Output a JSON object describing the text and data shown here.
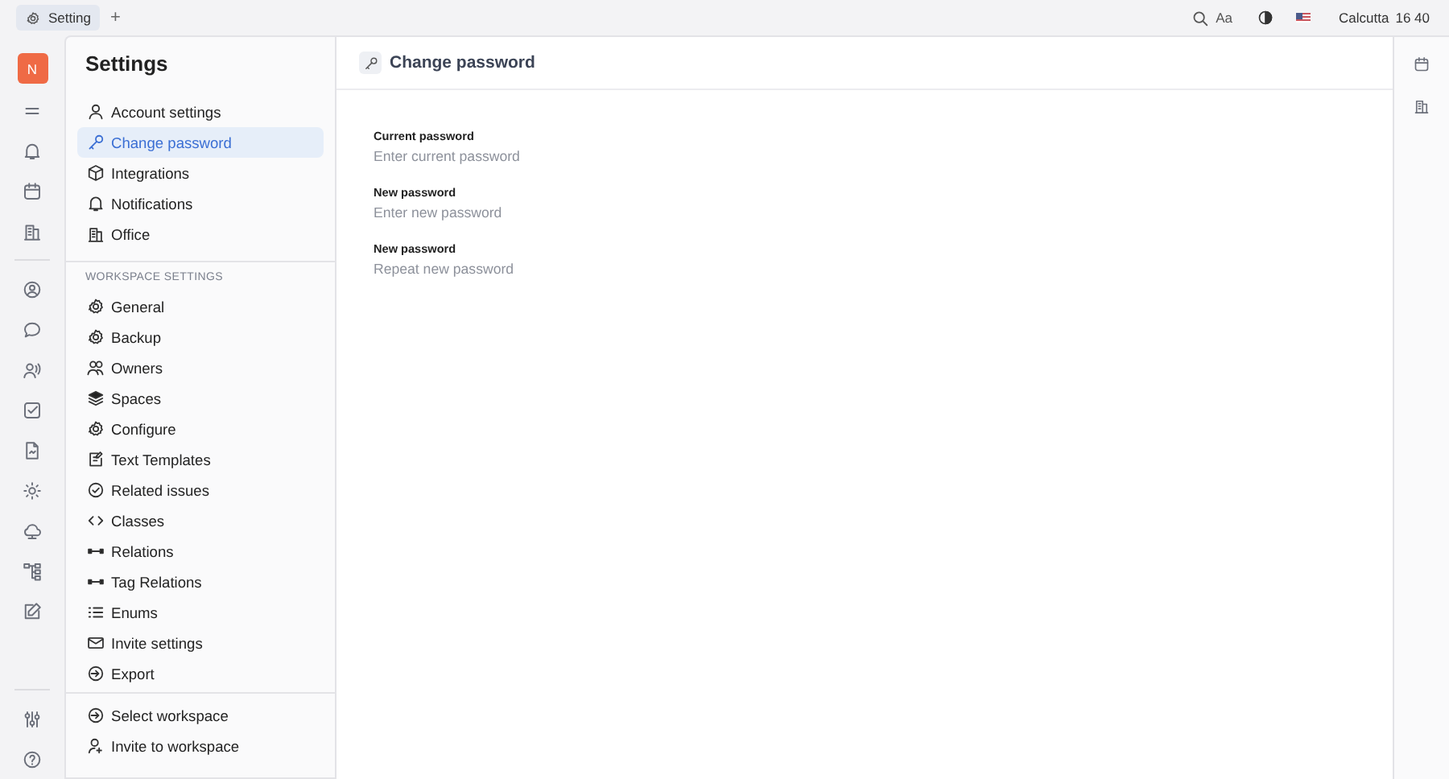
{
  "tabs": [
    {
      "label": "Setting",
      "selected": true
    }
  ],
  "new_tab": "+",
  "top_bar": {
    "font_button": "Aa",
    "city": "Calcutta",
    "time": "16 40"
  },
  "rail": {
    "avatar": "N"
  },
  "sidebar": {
    "title": "Settings",
    "items": [
      {
        "label": "Account settings",
        "selected": false
      },
      {
        "label": "Change password",
        "selected": true
      },
      {
        "label": "Integrations",
        "selected": false
      },
      {
        "label": "Notifications",
        "selected": false
      },
      {
        "label": "Office",
        "selected": false
      }
    ],
    "workspace_heading": "WORKSPACE SETTINGS",
    "workspace_items": [
      {
        "label": "General",
        "selected": false
      },
      {
        "label": "Backup",
        "selected": false
      },
      {
        "label": "Owners",
        "selected": false
      },
      {
        "label": "Spaces",
        "selected": false
      },
      {
        "label": "Configure",
        "selected": false
      },
      {
        "label": "Text Templates",
        "selected": false
      },
      {
        "label": "Related issues",
        "selected": false
      },
      {
        "label": "Classes",
        "selected": false
      },
      {
        "label": "Relations",
        "selected": false
      },
      {
        "label": "Tag Relations",
        "selected": false
      },
      {
        "label": "Enums",
        "selected": false
      },
      {
        "label": "Invite settings",
        "selected": false
      },
      {
        "label": "Export",
        "selected": false
      }
    ],
    "footer_items": [
      {
        "label": "Select workspace"
      },
      {
        "label": "Invite to workspace"
      }
    ]
  },
  "main": {
    "title": "Change password",
    "fields": [
      {
        "label": "Current password",
        "placeholder": "Enter current password"
      },
      {
        "label": "New password",
        "placeholder": "Enter new password"
      },
      {
        "label": "New password",
        "placeholder": "Repeat new password"
      }
    ]
  }
}
